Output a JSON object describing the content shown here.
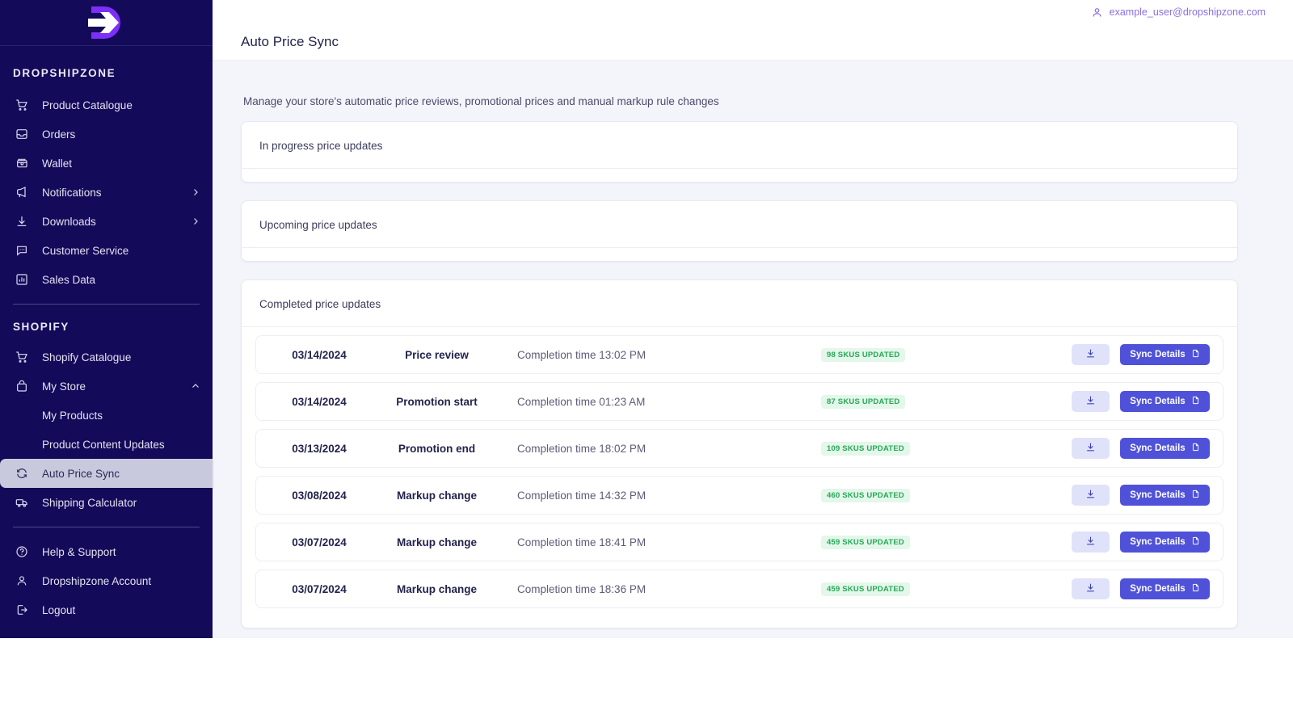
{
  "brand": {
    "logo_icon": "dropshipzone-logo-icon",
    "name": "DROPSHIPZONE"
  },
  "header": {
    "user_icon": "user-icon",
    "user_email": "example_user@dropshipzone.com",
    "page_title": "Auto Price Sync"
  },
  "main": {
    "subtitle": "Manage your store's automatic price reviews, promotional prices and manual markup rule changes"
  },
  "sidebar": {
    "section1_items": [
      {
        "label": "Product Catalogue",
        "icon": "cart-icon",
        "chevron": ""
      },
      {
        "label": "Orders",
        "icon": "inbox-icon",
        "chevron": ""
      },
      {
        "label": "Wallet",
        "icon": "wallet-icon",
        "chevron": ""
      },
      {
        "label": "Notifications",
        "icon": "megaphone-icon",
        "chevron": "chevron-right-icon"
      },
      {
        "label": "Downloads",
        "icon": "download-icon",
        "chevron": "chevron-right-icon"
      },
      {
        "label": "Customer Service",
        "icon": "chat-icon",
        "chevron": ""
      },
      {
        "label": "Sales Data",
        "icon": "bar-chart-icon",
        "chevron": ""
      }
    ],
    "section2_title": "SHOPIFY",
    "section2_items": [
      {
        "label": "Shopify Catalogue",
        "icon": "cart-icon",
        "chevron": ""
      },
      {
        "label": "My Store",
        "icon": "bag-icon",
        "chevron": "chevron-up-icon"
      },
      {
        "label": "My Products",
        "icon": "",
        "chevron": ""
      },
      {
        "label": "Product Content Updates",
        "icon": "",
        "chevron": ""
      },
      {
        "label": "Auto Price Sync",
        "icon": "sync-icon",
        "chevron": ""
      },
      {
        "label": "Shipping Calculator",
        "icon": "truck-icon",
        "chevron": ""
      }
    ],
    "section3_items": [
      {
        "label": "Help & Support",
        "icon": "help-circle-icon"
      },
      {
        "label": "Dropshipzone Account",
        "icon": "person-icon"
      },
      {
        "label": "Logout",
        "icon": "logout-icon"
      }
    ],
    "active_item": "Auto Price Sync"
  },
  "panels": {
    "in_progress_title": "In progress price updates",
    "upcoming_title": "Upcoming price updates",
    "completed_title": "Completed price updates"
  },
  "completed_rows": [
    {
      "date": "03/14/2024",
      "type": "Price review",
      "time": "Completion time 13:02 PM",
      "badge": "98 SKUS UPDATED",
      "download_icon": "download-icon",
      "sync_label": "Sync Details",
      "sync_icon": "document-icon"
    },
    {
      "date": "03/14/2024",
      "type": "Promotion start",
      "time": "Completion time 01:23 AM",
      "badge": "87 SKUS UPDATED",
      "download_icon": "download-icon",
      "sync_label": "Sync Details",
      "sync_icon": "document-icon"
    },
    {
      "date": "03/13/2024",
      "type": "Promotion end",
      "time": "Completion time 18:02 PM",
      "badge": "109 SKUS UPDATED",
      "download_icon": "download-icon",
      "sync_label": "Sync Details",
      "sync_icon": "document-icon"
    },
    {
      "date": "03/08/2024",
      "type": "Markup change",
      "time": "Completion time 14:32 PM",
      "badge": "460 SKUS UPDATED",
      "download_icon": "download-icon",
      "sync_label": "Sync Details",
      "sync_icon": "document-icon"
    },
    {
      "date": "03/07/2024",
      "type": "Markup change",
      "time": "Completion time 18:41 PM",
      "badge": "459 SKUS UPDATED",
      "download_icon": "download-icon",
      "sync_label": "Sync Details",
      "sync_icon": "document-icon"
    },
    {
      "date": "03/07/2024",
      "type": "Markup change",
      "time": "Completion time 18:36 PM",
      "badge": "459 SKUS UPDATED",
      "download_icon": "download-icon",
      "sync_label": "Sync Details",
      "sync_icon": "document-icon"
    }
  ],
  "colors": {
    "sidebar_bg": "#140a5a",
    "active_bg": "#c9c9dd",
    "accent_purple": "#8b6fe0",
    "primary_button": "#4f52d8",
    "badge_green": "#27a855",
    "content_bg": "#f4f4fb"
  }
}
